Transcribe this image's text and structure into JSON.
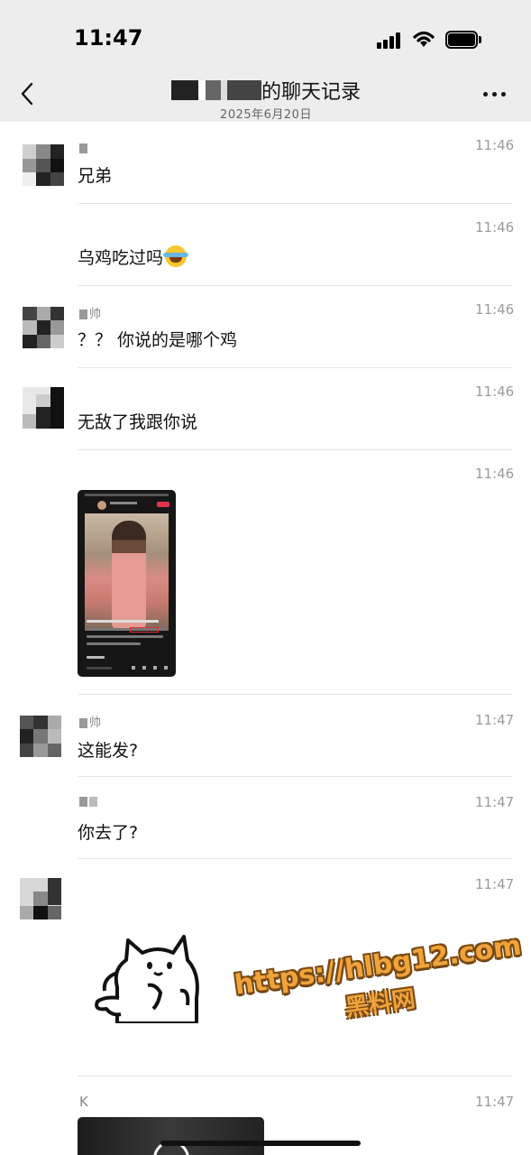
{
  "status_bar": {
    "time": "11:47"
  },
  "header": {
    "title_suffix": "的聊天记录",
    "date": "2025年6月20日"
  },
  "messages": [
    {
      "sender": "",
      "time": "11:46",
      "text": "兄弟"
    },
    {
      "sender": "",
      "time": "11:46",
      "text": "乌鸡吃过吗"
    },
    {
      "sender": "帅",
      "time": "11:46",
      "text": "？？ 你说的是哪个鸡"
    },
    {
      "sender": "",
      "time": "11:46",
      "text": "无敌了我跟你说"
    },
    {
      "sender": "",
      "time": "11:46",
      "text": ""
    },
    {
      "sender": "帅",
      "time": "11:47",
      "text": "这能发?"
    },
    {
      "sender": "",
      "time": "11:47",
      "text": "你去了?"
    },
    {
      "sender": "",
      "time": "11:47",
      "text": ""
    },
    {
      "sender": "K",
      "time": "11:47",
      "text": ""
    }
  ],
  "watermark": {
    "url": "https://hlbg12.com",
    "name": "黑料网"
  },
  "icons": {
    "back": "chevron-left-icon",
    "more": "ellipsis-icon",
    "signal": "signal-icon",
    "wifi": "wifi-icon",
    "battery": "battery-icon",
    "emoji": "tears-of-joy-emoji"
  },
  "colors": {
    "header_bg": "#ededed",
    "watermark": "#f0a33a"
  }
}
